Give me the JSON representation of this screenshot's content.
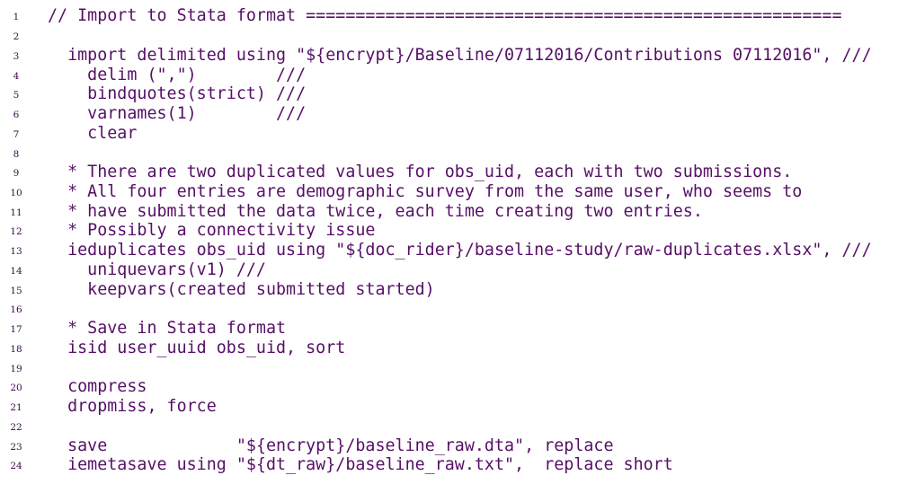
{
  "listing": {
    "lines": [
      "// Import to Stata format ======================================================",
      "",
      "  import delimited using \"${encrypt}/Baseline/07112016/Contributions 07112016\", ///",
      "    delim (\",\")        ///",
      "    bindquotes(strict) ///",
      "    varnames(1)        ///",
      "    clear",
      "",
      "  * There are two duplicated values for obs_uid, each with two submissions.",
      "  * All four entries are demographic survey from the same user, who seems to",
      "  * have submitted the data twice, each time creating two entries.",
      "  * Possibly a connectivity issue",
      "  ieduplicates obs_uid using \"${doc_rider}/baseline-study/raw-duplicates.xlsx\", ///",
      "    uniquevars(v1) ///",
      "    keepvars(created submitted started)",
      "",
      "  * Save in Stata format",
      "  isid user_uuid obs_uid, sort",
      "",
      "  compress",
      "  dropmiss, force",
      "",
      "  save             \"${encrypt}/baseline_raw.dta\", replace",
      "  iemetasave using \"${dt_raw}/baseline_raw.txt\",  replace short"
    ]
  }
}
